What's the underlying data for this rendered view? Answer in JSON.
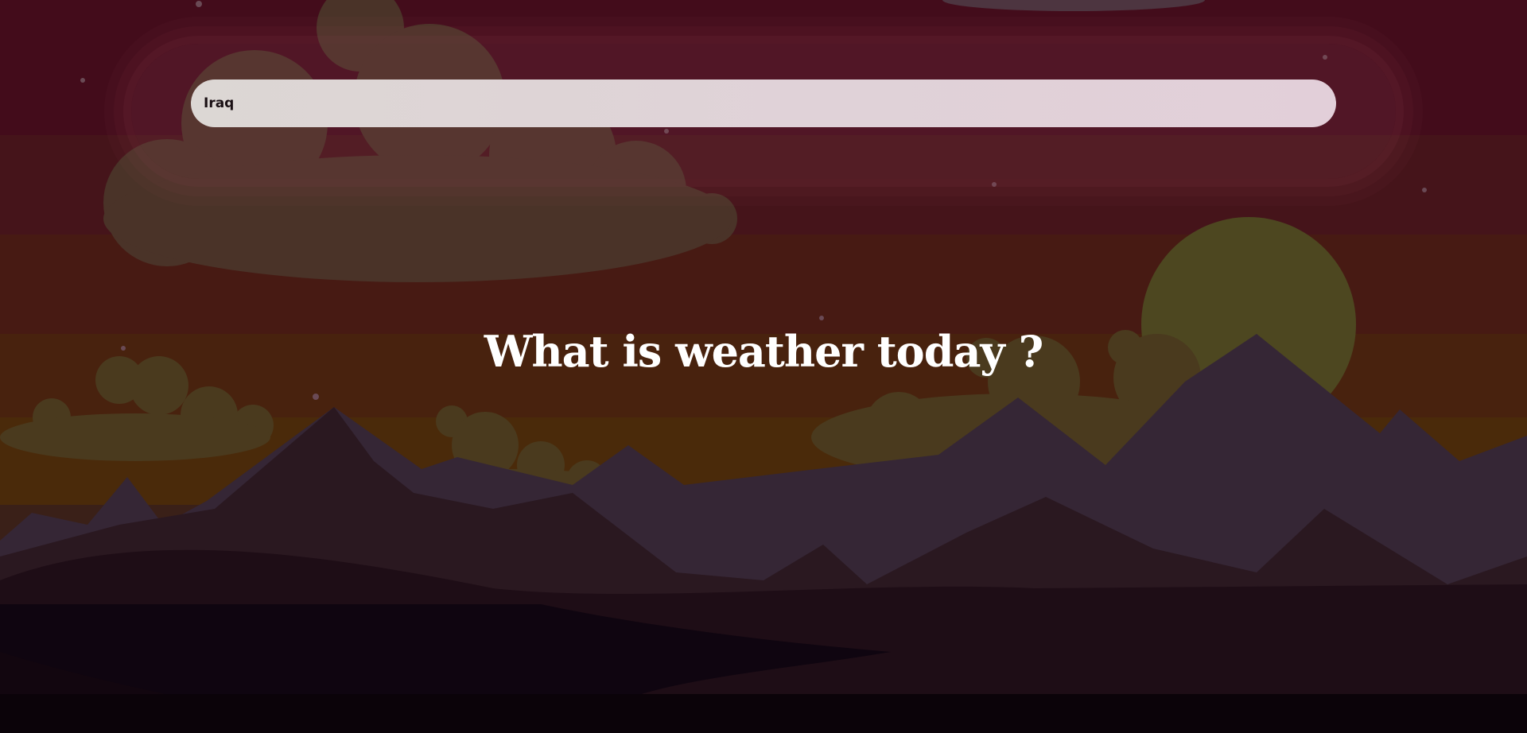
{
  "search": {
    "value": "Iraq",
    "placeholder": ""
  },
  "heading": {
    "text": "What is weather today ?"
  },
  "colors": {
    "sky_top": "#430c1b",
    "sky_mid": "#471a13",
    "sky_low": "#4a2a0a",
    "sun": "#4d4720",
    "cloud": "#4a3328",
    "mountain_far": "#352635",
    "mountain_near": "#241319",
    "ground": "#12050e",
    "search_bg": "#e0d2d8",
    "heading_text": "#ffffff"
  }
}
